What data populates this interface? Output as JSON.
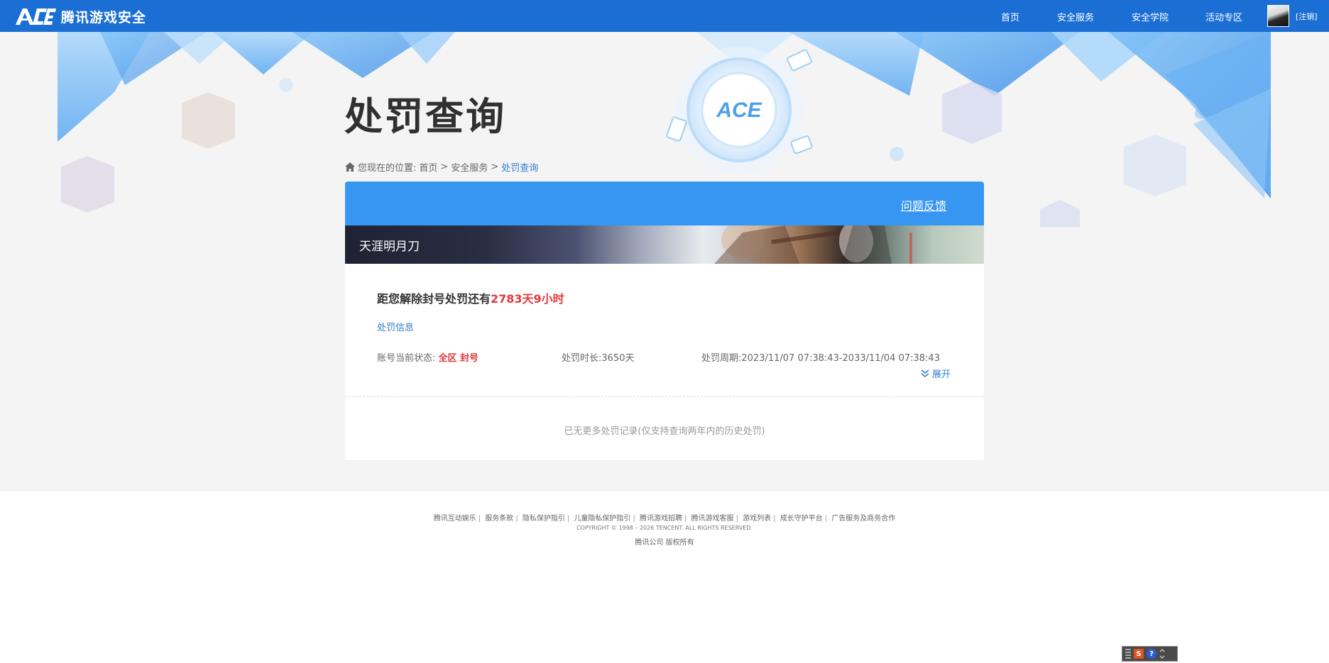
{
  "brand": {
    "logo_text": "腾讯游戏安全",
    "logo_mark": "ACE"
  },
  "nav": {
    "items": [
      {
        "label": "首页"
      },
      {
        "label": "安全服务"
      },
      {
        "label": "安全学院"
      },
      {
        "label": "活动专区"
      }
    ],
    "logout_label": "[注销]"
  },
  "page": {
    "title": "处罚查询"
  },
  "breadcrumb": {
    "prefix": "您现在的位置:",
    "items": [
      "首页",
      "安全服务",
      "处罚查询"
    ],
    "separator": ">"
  },
  "card": {
    "feedback_label": "问题反馈",
    "game_name": "天涯明月刀",
    "countdown_prefix": "距您解除封号处罚还有",
    "countdown_value": "2783天9小时",
    "section_label": "处罚信息",
    "status_label": "账号当前状态:",
    "status_value": "全区 封号",
    "duration_label": "处罚时长:",
    "duration_value": "3650天",
    "period_label": "处罚周期:",
    "period_value": "2023/11/07 07:38:43-2033/11/04 07:38:43",
    "expand_label": "展开",
    "no_more_text": "已无更多处罚记录(仅支持查询两年内的历史处罚)"
  },
  "footer": {
    "links": [
      "腾讯互动娱乐",
      "服务条款",
      "隐私保护指引",
      "儿童隐私保护指引",
      "腾讯游戏招聘",
      "腾讯游戏客服",
      "游戏列表",
      "成长守护平台",
      "广告服务及商务合作"
    ],
    "copyright": "COPYRIGHT © 1998 – 2026 TENCENT. ALL RIGHTS RESERVED.",
    "company": "腾讯公司 版权所有"
  },
  "ime_toolbar": {
    "brand_glyph": "S",
    "help_glyph": "?"
  },
  "colors": {
    "nav_bg": "#1b6fd4",
    "card_header": "#3896f3",
    "accent_red": "#e0393e",
    "link_blue": "#2f7fd0"
  }
}
